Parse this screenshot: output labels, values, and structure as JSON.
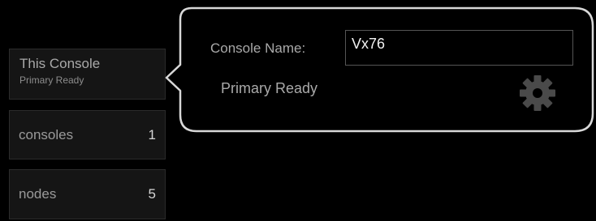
{
  "sidebar": {
    "this_console": {
      "title": "This Console",
      "subtitle": "Primary Ready"
    },
    "consoles": {
      "label": "consoles",
      "count": "1"
    },
    "nodes": {
      "label": "nodes",
      "count": "5"
    }
  },
  "popover": {
    "console_name_label": "Console Name:",
    "console_name_value": "Vx76",
    "status": "Primary Ready",
    "settings_icon": "gear-icon"
  },
  "colors": {
    "background": "#000000",
    "tile_bg": "#151515",
    "popover_border": "#d8d8d8",
    "text_muted": "#a9a9a9",
    "icon": "#4a4a4a"
  }
}
